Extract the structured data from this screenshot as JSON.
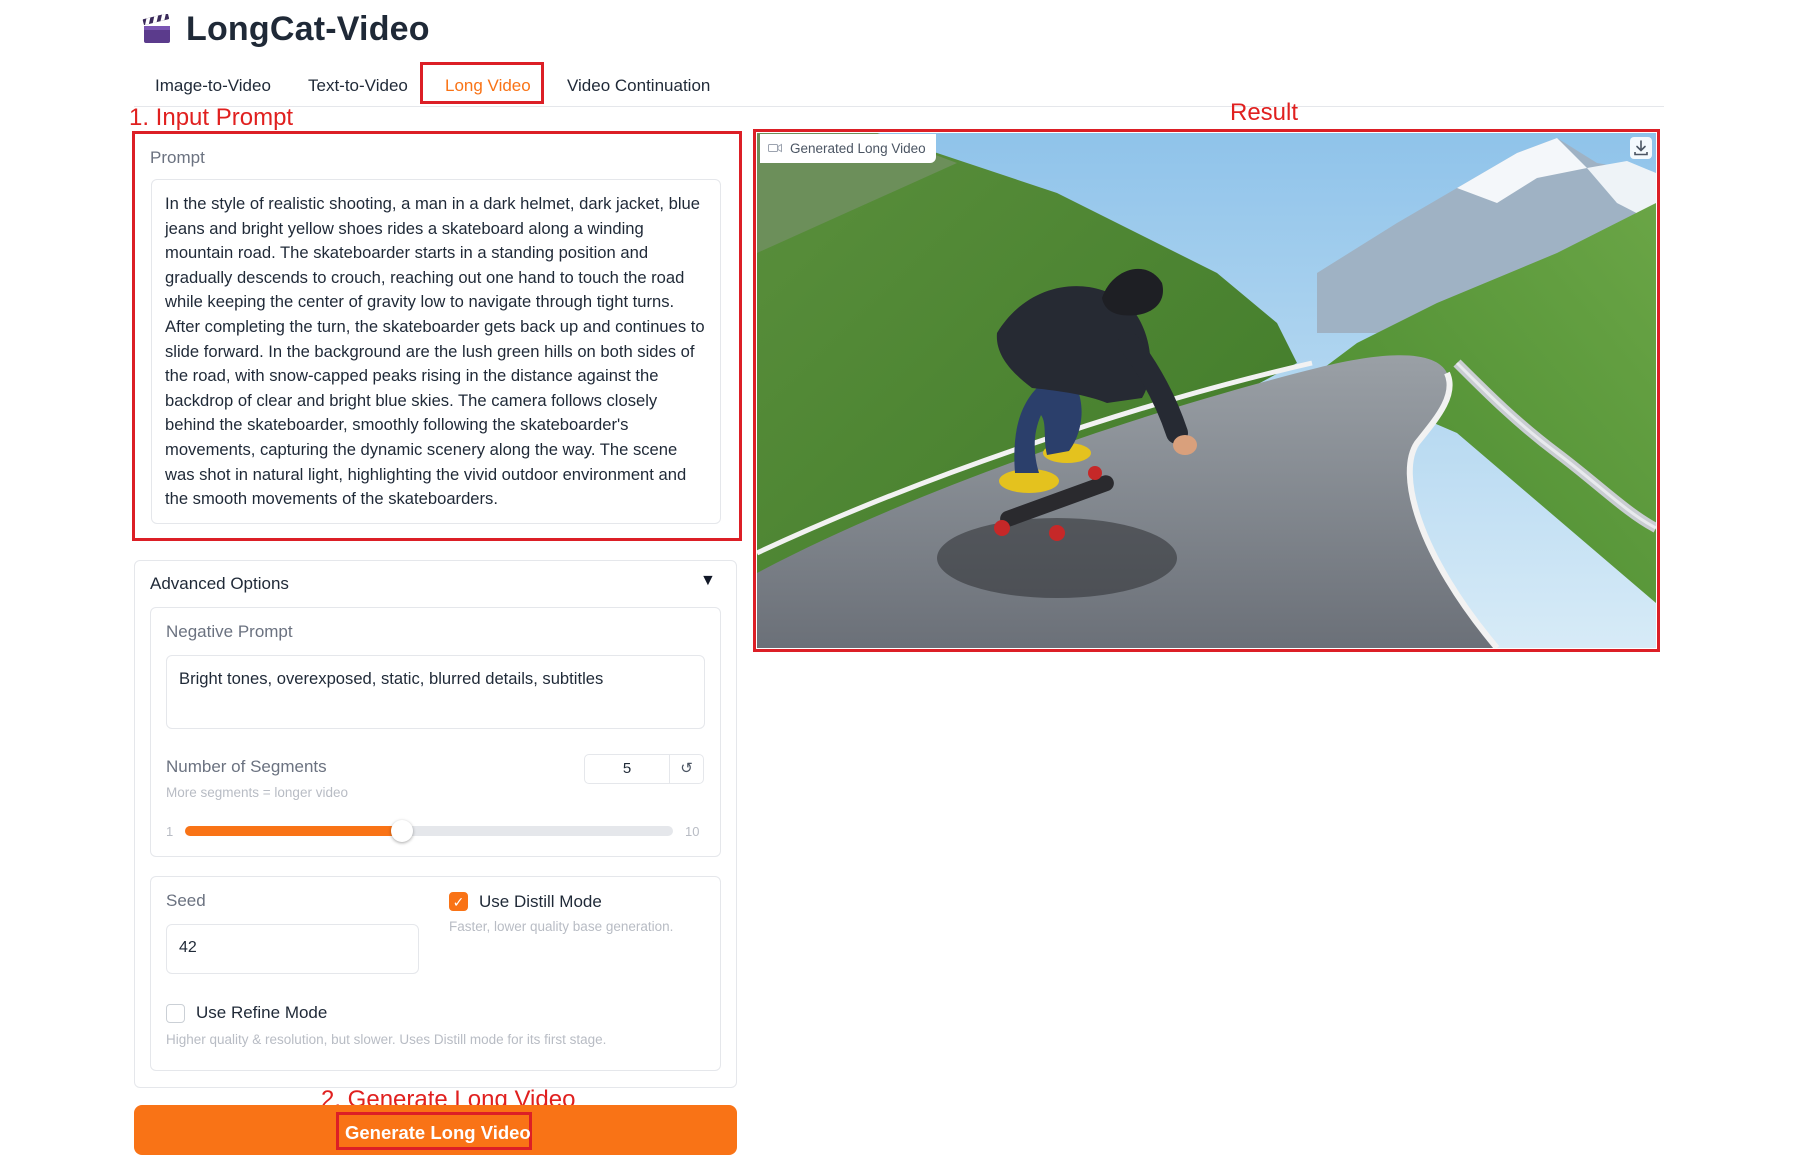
{
  "app": {
    "title": "LongCat-Video"
  },
  "tabs": [
    {
      "label": "Image-to-Video"
    },
    {
      "label": "Text-to-Video"
    },
    {
      "label": "Long Video"
    },
    {
      "label": "Video Continuation"
    }
  ],
  "active_tab": "Long Video",
  "annotations": {
    "step1": "1. Input Prompt",
    "result": "Result",
    "step2": "2. Generate Long Video"
  },
  "prompt": {
    "label": "Prompt",
    "value": "In the style of realistic shooting, a man in a dark helmet, dark jacket, blue jeans and bright yellow shoes rides a skateboard along a winding mountain road. The skateboarder starts in a standing position and gradually descends to crouch, reaching out one hand to touch the road while keeping the center of gravity low to navigate through tight turns. After completing the turn, the skateboarder gets back up and continues to slide forward. In the background are the lush green hills on both sides of the road, with snow-capped peaks rising in the distance against the backdrop of clear and bright blue skies. The camera follows closely behind the skateboarder, smoothly following the skateboarder's movements, capturing the dynamic scenery along the way. The scene was shot in natural light, highlighting the vivid outdoor environment and the smooth movements of the skateboarders."
  },
  "advanced": {
    "label": "Advanced Options",
    "toggle_symbol": "▼",
    "negative_prompt": {
      "label": "Negative Prompt",
      "value": "Bright tones, overexposed, static, blurred details, subtitles"
    },
    "segments": {
      "label": "Number of Segments",
      "info": "More segments = longer video",
      "value": "5",
      "min": "1",
      "max": "10",
      "fraction": 0.444,
      "reset_symbol": "↺"
    },
    "seed": {
      "label": "Seed",
      "value": "42"
    },
    "distill": {
      "label": "Use Distill Mode",
      "info": "Faster, lower quality base generation.",
      "checked": true
    },
    "refine": {
      "label": "Use Refine Mode",
      "info": "Higher quality & resolution, but slower. Uses Distill mode for its first stage.",
      "checked": false
    }
  },
  "generate_button": {
    "label": "Generate Long Video"
  },
  "video": {
    "label": "Generated Long Video",
    "icons": [
      "video-camera-icon",
      "download-icon"
    ]
  },
  "colors": {
    "accent": "#f97316",
    "annotation_red": "#dc1f26",
    "border": "#e5e7eb"
  }
}
